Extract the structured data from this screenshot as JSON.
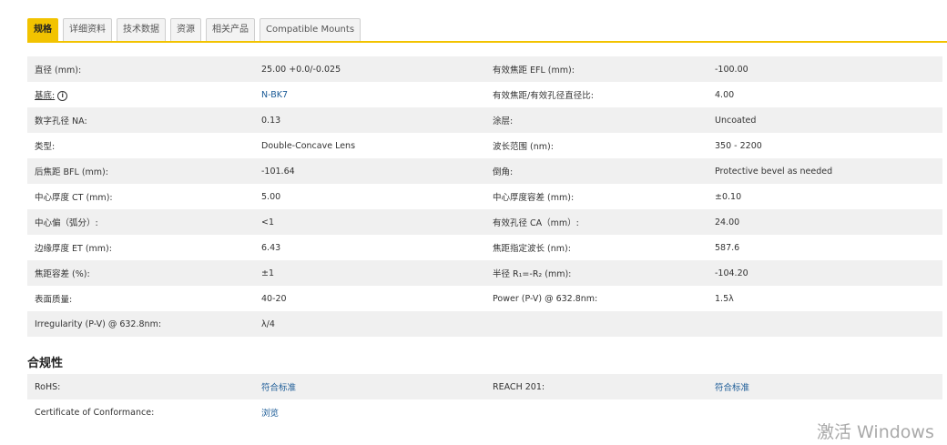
{
  "tabs": [
    {
      "label": "规格",
      "active": true
    },
    {
      "label": "详细资料",
      "active": false
    },
    {
      "label": "技术数据",
      "active": false
    },
    {
      "label": "资源",
      "active": false
    },
    {
      "label": "相关产品",
      "active": false
    },
    {
      "label": "Compatible Mounts",
      "active": false
    }
  ],
  "specs": {
    "rows": [
      {
        "l1": "直径 (mm):",
        "v1": "25.00 +0.0/-0.025",
        "l2": "有效焦距 EFL (mm):",
        "v2": "-100.00"
      },
      {
        "l1": "基底:",
        "v1": "N-BK7",
        "l2": "有效焦距/有效孔径直径比:",
        "v2": "4.00"
      },
      {
        "l1": "数字孔径 NA:",
        "v1": "0.13",
        "l2": "涂层:",
        "v2": "Uncoated"
      },
      {
        "l1": "类型:",
        "v1": "Double-Concave Lens",
        "l2": "波长范围 (nm):",
        "v2": "350 - 2200"
      },
      {
        "l1": "后焦距 BFL (mm):",
        "v1": "-101.64",
        "l2": "倒角:",
        "v2": "Protective bevel as needed"
      },
      {
        "l1": "中心厚度 CT (mm):",
        "v1": "5.00",
        "l2": "中心厚度容差 (mm):",
        "v2": "±0.10"
      },
      {
        "l1": "中心偏（弧分）:",
        "v1": "<1",
        "l2": "有效孔径 CA（mm）:",
        "v2": "24.00"
      },
      {
        "l1": "边缘厚度 ET (mm):",
        "v1": "6.43",
        "l2": "焦距指定波长 (nm):",
        "v2": "587.6"
      },
      {
        "l1": "焦距容差 (%):",
        "v1": "±1",
        "l2": "半径 R₁=-R₂ (mm):",
        "v2": "-104.20"
      },
      {
        "l1": "表面质量:",
        "v1": "40-20",
        "l2": "Power (P-V) @ 632.8nm:",
        "v2": "1.5λ"
      },
      {
        "l1": "Irregularity (P-V) @ 632.8nm:",
        "v1": "λ/4",
        "l2": "",
        "v2": ""
      }
    ]
  },
  "compliance": {
    "title": "合规性",
    "rows": [
      {
        "l1": "RoHS:",
        "v1": "符合标准",
        "l2": "REACH 201:",
        "v2": "符合标准"
      },
      {
        "l1": "Certificate of Conformance:",
        "v1": "浏览",
        "l2": "",
        "v2": ""
      }
    ]
  },
  "watermark": "激活 Windows",
  "colors": {
    "accent": "#f2c300",
    "link": "#1a5a96",
    "row_alt": "#f0f0f0"
  },
  "icons": {
    "substrate_info": "info-icon"
  }
}
